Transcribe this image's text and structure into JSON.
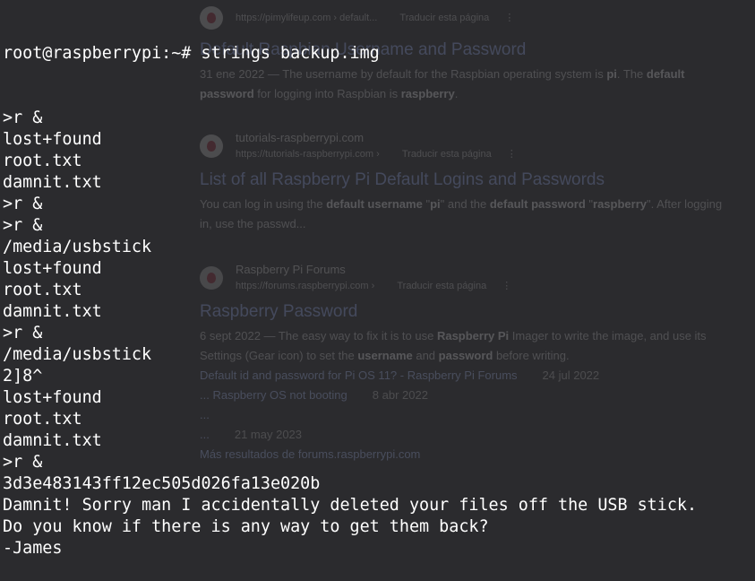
{
  "terminal": {
    "prompt": "root@raspberrypi:~#",
    "command": "strings backup.img",
    "lines": [
      ">r &",
      "lost+found",
      "root.txt",
      "damnit.txt",
      ">r &",
      ">r &",
      "/media/usbstick",
      "lost+found",
      "root.txt",
      "damnit.txt",
      ">r &",
      "/media/usbstick",
      "2]8^",
      "lost+found",
      "root.txt",
      "damnit.txt",
      ">r &",
      "3d3e483143ff12ec505d026fa13e020b",
      "Damnit! Sorry man I accidentally deleted your files off the USB stick.",
      "Do you know if there is any way to get them back?",
      "-James"
    ]
  },
  "background": {
    "results": [
      {
        "site": "",
        "url": "https://pimylifeup.com › default...",
        "translate": "Traducir esta página",
        "title": "Default Raspbian Username and Password",
        "snippet_html": "31 ene 2022 — The username by default for the Raspbian operating system is <b>pi</b>. The <b>default password</b> for logging into Raspbian is <b>raspberry</b>."
      },
      {
        "site": "tutorials-raspberrypi.com",
        "url": "https://tutorials-raspberrypi.com ›",
        "translate": "Traducir esta página",
        "title": "List of all Raspberry Pi Default Logins and Passwords",
        "snippet_html": "You can log in using the <b>default username</b> \"<b>pi</b>\" and the <b>default password</b> \"<b>raspberry</b>\". After logging in, use the passwd..."
      },
      {
        "site": "Raspberry Pi Forums",
        "url": "https://forums.raspberrypi.com ›",
        "translate": "Traducir esta página",
        "title": "Raspberry Password",
        "snippet_html": "6 sept 2022 — The easy way to fix it is to use <b>Raspberry Pi</b> Imager to write the image, and use its Settings (Gear icon) to set the <b>username</b> and <b>password</b> before writing.",
        "sublinks": [
          {
            "text": "Default id and password for Pi OS 11? - Raspberry Pi Forums",
            "date": "24 jul 2022"
          },
          {
            "text": "... Raspberry OS not booting",
            "date": "8 abr 2022"
          },
          {
            "text": "...",
            "date": ""
          },
          {
            "text": "...",
            "date": "21 may 2023"
          }
        ],
        "more": "Más resultados de forums.raspberrypi.com"
      }
    ]
  }
}
